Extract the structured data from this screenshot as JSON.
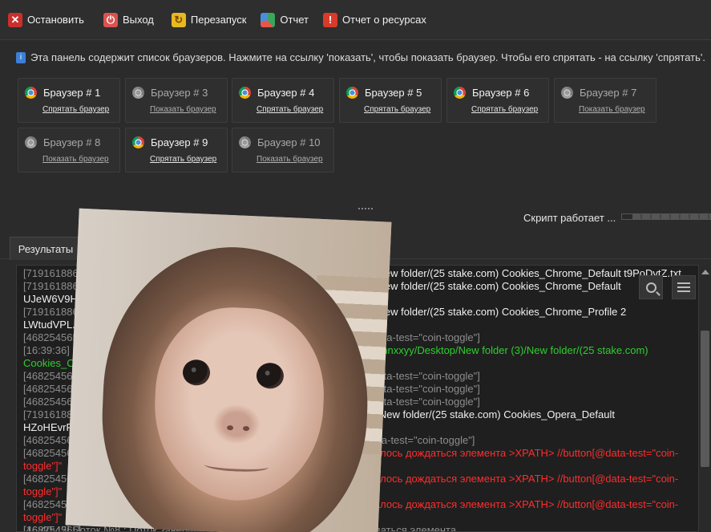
{
  "toolbar": {
    "stop_label": "Остановить",
    "exit_label": "Выход",
    "restart_label": "Перезапуск",
    "report_label": "Отчет",
    "resource_report_label": "Отчет о ресурсах"
  },
  "info": {
    "text": "Эта панель содержит список браузеров. Нажмите на ссылку 'показать', чтобы показать браузер. Чтобы его спрятать - на ссылку 'спрятать'."
  },
  "browsers": [
    {
      "name": "Браузер # 1",
      "link": "Спрятать браузер",
      "active": true
    },
    {
      "name": "Браузер # 3",
      "link": "Показать браузер",
      "active": false
    },
    {
      "name": "Браузер # 4",
      "link": "Спрятать браузер",
      "active": true
    },
    {
      "name": "Браузер # 5",
      "link": "Спрятать браузер",
      "active": true
    },
    {
      "name": "Браузер # 6",
      "link": "Спрятать браузер",
      "active": true
    },
    {
      "name": "Браузер # 7",
      "link": "Показать браузер",
      "active": false
    },
    {
      "name": "Браузер # 8",
      "link": "Показать браузер",
      "active": false
    },
    {
      "name": "Браузер # 9",
      "link": "Спрятать браузер",
      "active": true
    },
    {
      "name": "Браузер # 10",
      "link": "Показать браузер",
      "active": false
    }
  ],
  "status": {
    "text": "Скрипт работает ..."
  },
  "tabs": {
    "results": "Результаты"
  },
  "log": {
    "lines": [
      {
        "prefix": "[719161886]",
        "text": "(3)/New folder/(25 stake.com) Cookies_Chrome_Default t9PoDvtZ.txt",
        "color": "white"
      },
      {
        "prefix": "[719161886]",
        "text": "(3)/New folder/(25 stake.com) Cookies_Chrome_Default",
        "color": "white"
      },
      {
        "prefix": "",
        "text": "UJeW6V9H.txt",
        "color": "white"
      },
      {
        "prefix": "[719161886]",
        "text": "(3)/New folder/(25 stake.com) Cookies_Chrome_Profile 2",
        "color": "white"
      },
      {
        "prefix": "",
        "text": "LWtudVPL.txt",
        "color": "white"
      },
      {
        "prefix": "[468254565]",
        "text": "@data-test=\"coin-toggle\"]",
        "color": "gray"
      },
      {
        "prefix": "[16:39:36]",
        "text": "s/Winnxxyy/Desktop/New folder (3)/New folder/(25 stake.com)",
        "color": "green"
      },
      {
        "prefix": "",
        "text": "Cookies_Chr",
        "color": "green"
      },
      {
        "prefix": "[468254565]",
        "text": "@data-test=\"coin-toggle\"]",
        "color": "gray"
      },
      {
        "prefix": "[468254565]",
        "text": "@data-test=\"coin-toggle\"]",
        "color": "gray"
      },
      {
        "prefix": "[468254565]",
        "text": "@data-test=\"coin-toggle\"]",
        "color": "gray"
      },
      {
        "prefix": "[719161886]",
        "text": "der (3)/New folder/(25 stake.com) Cookies_Opera_Default",
        "color": "white"
      },
      {
        "prefix": "",
        "text": "HZoHEvrR.tx",
        "color": "white"
      },
      {
        "prefix": "[468254565]",
        "text": "[@data-test=\"coin-toggle\"]",
        "color": "gray"
      },
      {
        "prefix": "[468254565]",
        "text": "Не удалось дождаться элемента >XPATH> //button[@data-test=\"coin-",
        "color": "red"
      },
      {
        "prefix": "",
        "text": "toggle\"]\"",
        "color": "red"
      },
      {
        "prefix": "[468254565]",
        "text": "Не удалось дождаться элемента >XPATH> //button[@data-test=\"coin-",
        "color": "red"
      },
      {
        "prefix": "",
        "text": "toggle\"]\"",
        "color": "red"
      },
      {
        "prefix": "[468254565]",
        "text": "Не удалось дождаться элемента >XPATH> //button[@data-test=\"coin-",
        "color": "red"
      },
      {
        "prefix": "",
        "text": "toggle\"]\"",
        "color": "red"
      },
      {
        "prefix": "[468254565]",
        "text": "[16:40:42] Поток №8 : Поток завершился с сообщением: Не удалось дождаться элемента",
        "color": "gray"
      }
    ]
  },
  "colors": {
    "background": "#2b2b2b",
    "log_background": "#1f1f1f",
    "log_gray": "#8d8d8d",
    "log_green": "#2fce2f",
    "log_red": "#ff2d2d"
  },
  "icons": {
    "stop": "stop-icon",
    "exit": "power-icon",
    "restart": "restart-icon",
    "report": "pie-chart-icon",
    "resource_report": "alert-icon",
    "info": "info-icon",
    "browser": "chrome-icon",
    "search": "search-icon",
    "menu": "menu-icon"
  }
}
